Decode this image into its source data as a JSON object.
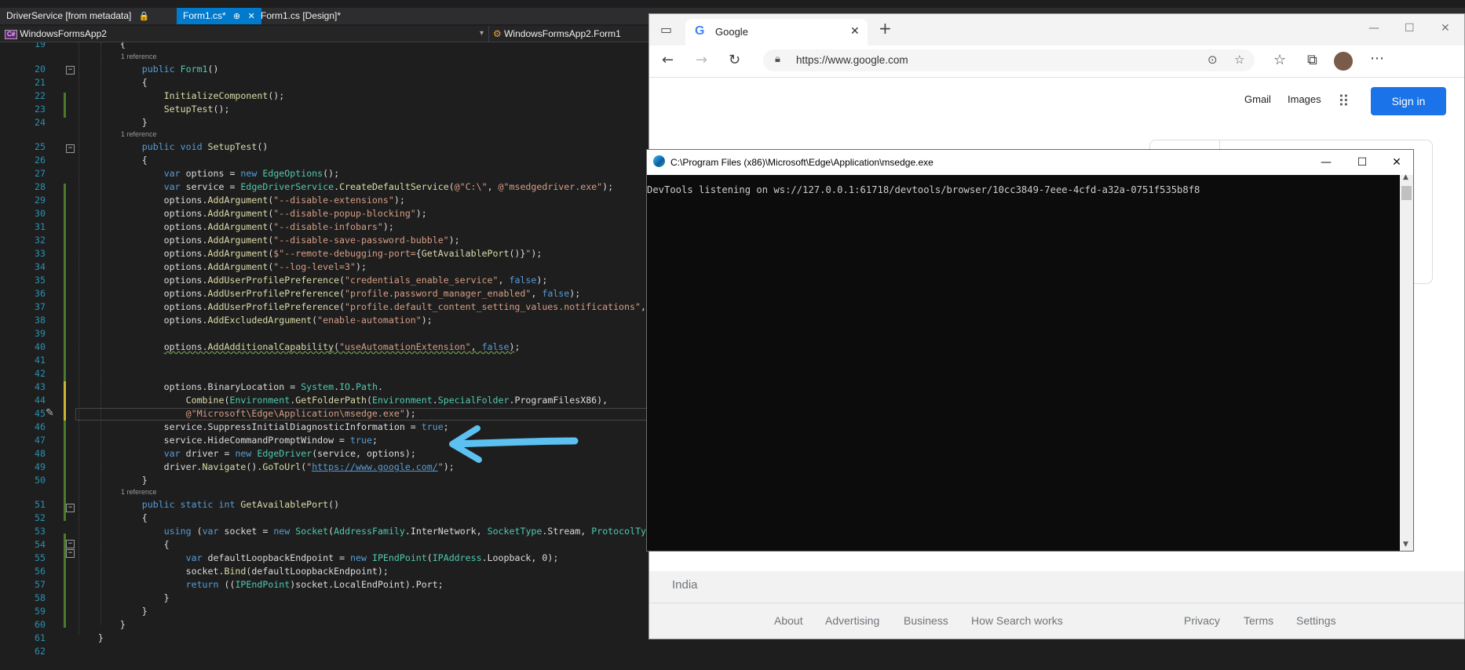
{
  "vs": {
    "tabs": [
      {
        "label": "DriverService [from metadata]",
        "glyph": "🔒"
      },
      {
        "label": "Form1.cs*",
        "pin": "⊕",
        "close": "✕"
      },
      {
        "label": "Form1.cs [Design]*"
      }
    ],
    "nav": {
      "project": "WindowsFormsApp2",
      "class": "WindowsFormsApp2.Form1",
      "cs_badge": "C#"
    },
    "ref_label": "1 reference",
    "line_numbers": [
      "19",
      "20",
      "21",
      "22",
      "23",
      "24",
      "25",
      "26",
      "27",
      "28",
      "29",
      "30",
      "31",
      "32",
      "33",
      "34",
      "35",
      "36",
      "37",
      "38",
      "39",
      "40",
      "41",
      "42",
      "43",
      "44",
      "45",
      "46",
      "47",
      "48",
      "49",
      "50",
      "51",
      "52",
      "53",
      "54",
      "55",
      "56",
      "57",
      "58",
      "59",
      "60",
      "61",
      "62"
    ]
  },
  "edge": {
    "tab_title": "Google",
    "url": "https://www.google.com",
    "header_links": [
      "Gmail",
      "Images"
    ],
    "sign_in": "Sign in",
    "country": "India",
    "footer_links": [
      "About",
      "Advertising",
      "Business",
      "How Search works",
      "Privacy",
      "Terms",
      "Settings"
    ],
    "colors": {
      "sign_in": "#1a73e8",
      "footer": "#f2f2f2"
    }
  },
  "console": {
    "title": "C:\\Program Files (x86)\\Microsoft\\Edge\\Application\\msedge.exe",
    "output": "DevTools listening on ws://127.0.0.1:61718/devtools/browser/10cc3849-7eee-4cfd-a32a-0751f535b8f8"
  }
}
